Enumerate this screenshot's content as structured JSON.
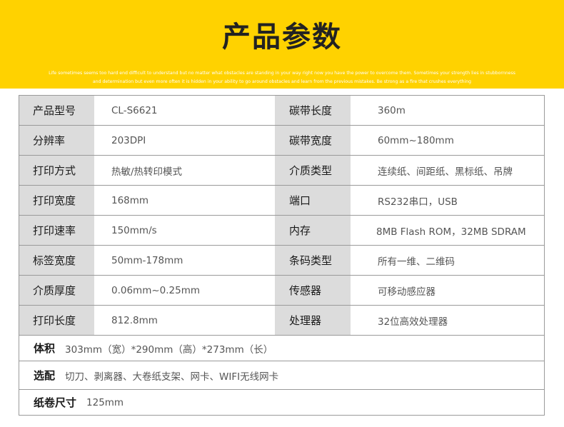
{
  "banner": {
    "title": "产品参数",
    "slogan_line1": "Life sometimes seems too hard end difficult to understand but no matter what obstacles are standing in your way right now you have the power to overcome them. Sometimes your strength lies in stubbornness",
    "slogan_line2": "and determination but even more often it is hidden in your ability to go around obstacles and learn from the previous mistakes. Be strong as a fire that crushes everything"
  },
  "specs": [
    {
      "label_left": "产品型号",
      "value_left": "CL-S6621",
      "label_right": "碳带长度",
      "value_right": "360m"
    },
    {
      "label_left": "分辨率",
      "value_left": "203DPI",
      "label_right": "碳带宽度",
      "value_right": "60mm~180mm"
    },
    {
      "label_left": "打印方式",
      "value_left": "热敏/热转印模式",
      "label_right": "介质类型",
      "value_right": "连续纸、间距纸、黑标纸、吊牌"
    },
    {
      "label_left": "打印宽度",
      "value_left": "168mm",
      "label_right": "端口",
      "value_right": "RS232串口，USB"
    },
    {
      "label_left": "打印速率",
      "value_left": "150mm/s",
      "label_right": "内存",
      "value_right": "8MB Flash ROM，32MB SDRAM"
    },
    {
      "label_left": "标签宽度",
      "value_left": "50mm-178mm",
      "label_right": "条码类型",
      "value_right": "所有一维、二维码"
    },
    {
      "label_left": "介质厚度",
      "value_left": "0.06mm~0.25mm",
      "label_right": "传感器",
      "value_right": "可移动感应器"
    },
    {
      "label_left": "打印长度",
      "value_left": "812.8mm",
      "label_right": "处理器",
      "value_right": "32位高效处理器"
    }
  ],
  "volume": {
    "label": "体积",
    "value": "303mm（宽）*290mm（高）*273mm（长）"
  },
  "options": {
    "label": "选配",
    "value": "切刀、剥离器、大卷纸支架、网卡、WIFI无线网卡"
  },
  "roll": {
    "label": "纸卷尺寸",
    "value": "125mm"
  }
}
